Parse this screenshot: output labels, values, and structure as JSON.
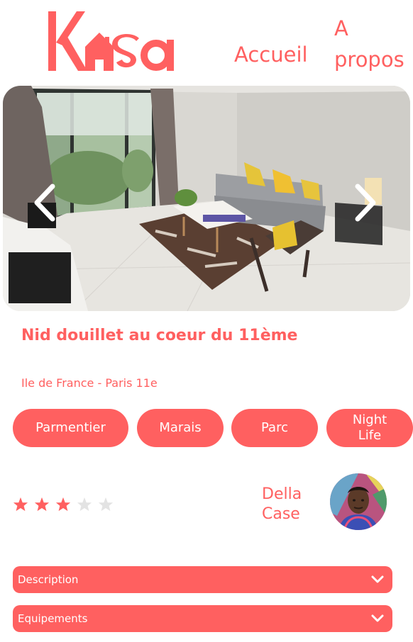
{
  "header": {
    "logo_text": "Kasa",
    "nav": {
      "home_label": "Accueil",
      "about_label": "A propos"
    }
  },
  "gallery": {
    "image_alt": "Nid douillet au coeur du 11ème",
    "prev_icon": "chevron-left-icon",
    "next_icon": "chevron-right-icon"
  },
  "listing": {
    "title": "Nid douillet au coeur du 11ème",
    "location": "Ile de France - Paris 11e",
    "tags": [
      "Parmentier",
      "Marais",
      "Parc",
      "Night Life"
    ],
    "rating": 3,
    "rating_max": 5,
    "host": {
      "name": "Della Case"
    }
  },
  "collapses": [
    {
      "label": "Description",
      "icon": "chevron-down-icon"
    },
    {
      "label": "Equipements",
      "icon": "chevron-down-icon"
    }
  ],
  "colors": {
    "brand": "#ff6060",
    "star_empty": "#e3e3e3",
    "text_on_brand": "#ffffff"
  }
}
